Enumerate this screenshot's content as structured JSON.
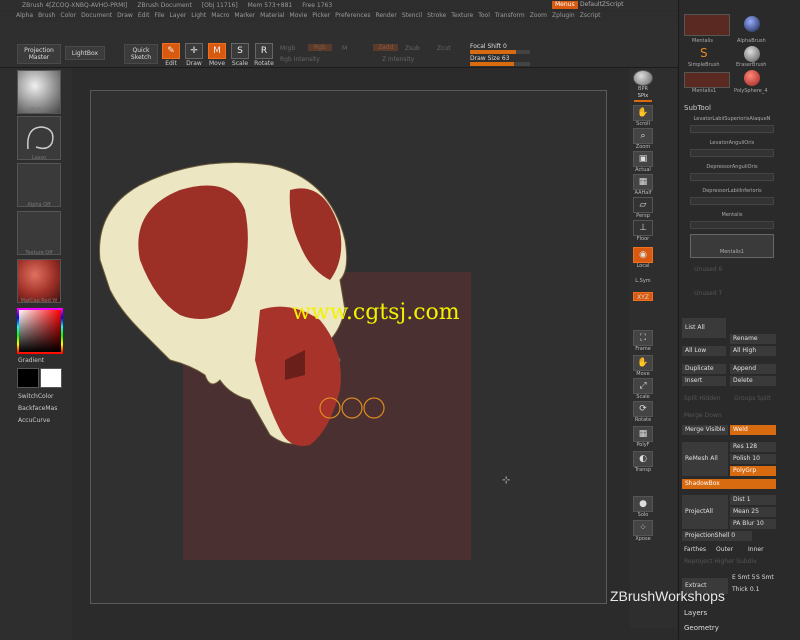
{
  "titlebar": {
    "app": "ZBrush 4[ZCOQ-XNBQ-AVHO-PRMI]",
    "doc": "ZBrush Document",
    "obj": "[Obj 11716]",
    "mem": "Mem 573+881",
    "free": "Free 1763",
    "menus": "Menus",
    "script": "DefaultZScript"
  },
  "menu": [
    "Alpha",
    "Brush",
    "Color",
    "Document",
    "Draw",
    "Edit",
    "File",
    "Layer",
    "Light",
    "Macro",
    "Marker",
    "Material",
    "Movie",
    "Picker",
    "Preferences",
    "Render",
    "Stencil",
    "Stroke",
    "Texture",
    "Tool",
    "Transform",
    "Zoom",
    "Zplugin",
    "Zscript"
  ],
  "toolbar": {
    "projection_master": "Projection Master",
    "lightbox": "LightBox",
    "quick_sketch": "Quick Sketch",
    "edit": "Edit",
    "draw": "Draw",
    "move": "Move",
    "scale": "Scale",
    "rotate": "Rotate",
    "mrgb": "Mrgb",
    "rgb": "Rgb",
    "m": "M",
    "rgb_intensity": "Rgb Intensity",
    "zadd": "Zadd",
    "zsub": "Zsub",
    "zcut": "Zcut",
    "z_intensity": "Z Intensity",
    "focal_shift": "Focal Shift",
    "focal_value": "0",
    "draw_size": "Draw Size",
    "draw_size_value": "63"
  },
  "left": {
    "matcap": "MatCap",
    "lasso": "Lasso",
    "alpha_off": "Alpha Off",
    "texture_off": "Texture Off",
    "material": "MatCap Red W",
    "gradient": "Gradient",
    "switch_color": "SwitchColor",
    "backface": "BackfaceMas",
    "accucurve": "AccuCurve"
  },
  "right": {
    "bpr": "BPR",
    "spix": "SPix",
    "scroll": "Scroll",
    "zoom": "Zoom",
    "actual": "Actual",
    "aahalf": "AAHalf",
    "persp": "Persp",
    "floor": "Floor",
    "local": "Local",
    "lsym": "L.Sym",
    "xyz": "XYZ",
    "frame": "Frame",
    "move": "Move",
    "scale": "Scale",
    "rotate": "Rotate",
    "polyf": "PolyF",
    "transp": "Transp",
    "solo": "Solo",
    "xpose": "Xpose"
  },
  "panel": {
    "top_tools": [
      "Mentalis",
      "AlphaBrush",
      "SimpleBrush",
      "EraserBrush",
      "Mentalis1",
      "PolySphere_4"
    ],
    "count": "24",
    "subtool_title": "SubTool",
    "subtools": [
      "LevatorLabiiSuperiorisAlaqueN",
      "LevatorAnguliOris",
      "DepressorAnguliOris",
      "DepressorLabiiInferioris",
      "Mentalis",
      "Mentalis1"
    ],
    "unused": [
      "Unused 6",
      "Unused 7"
    ],
    "list_all": "List All",
    "rename": "Rename",
    "all_low": "All Low",
    "all_high": "All High",
    "duplicate": "Duplicate",
    "append": "Append",
    "insert": "Insert",
    "delete": "Delete",
    "split_hidden": "Split Hidden",
    "groups_split": "Groups Split",
    "merge_down": "Merge Down",
    "merge_visible": "Merge Visible",
    "weld": "Weld",
    "remesh_all": "ReMesh All",
    "res": "Res",
    "res_value": "128",
    "polish": "Polish",
    "polish_value": "10",
    "polygrp": "PolyGrp",
    "shadowbox": "ShadowBox",
    "projectall": "ProjectAll",
    "dist": "Dist",
    "dist_value": "1",
    "mean": "Mean",
    "mean_value": "25",
    "pa_blur": "PA Blur",
    "pa_blur_value": "10",
    "projection_shell": "ProjectionShell",
    "projection_shell_value": "0",
    "farthest": "Farthes",
    "outer": "Outer",
    "inner": "Inner",
    "reproject": "Reproject Higher Subdiv",
    "extract": "Extract",
    "e_smt": "E Smt",
    "e_smt_value": "5",
    "s_smt": "S Smt",
    "thick": "Thick",
    "thick_value": "0.1",
    "layers": "Layers",
    "geometry": "Geometry"
  },
  "watermark": {
    "site": "www.cgtsj.com",
    "brand": "ZBrushWorkshops"
  },
  "colors": {
    "accent": "#d86a10",
    "skull": "#ece6c2",
    "muscle": "#9c2f26"
  }
}
